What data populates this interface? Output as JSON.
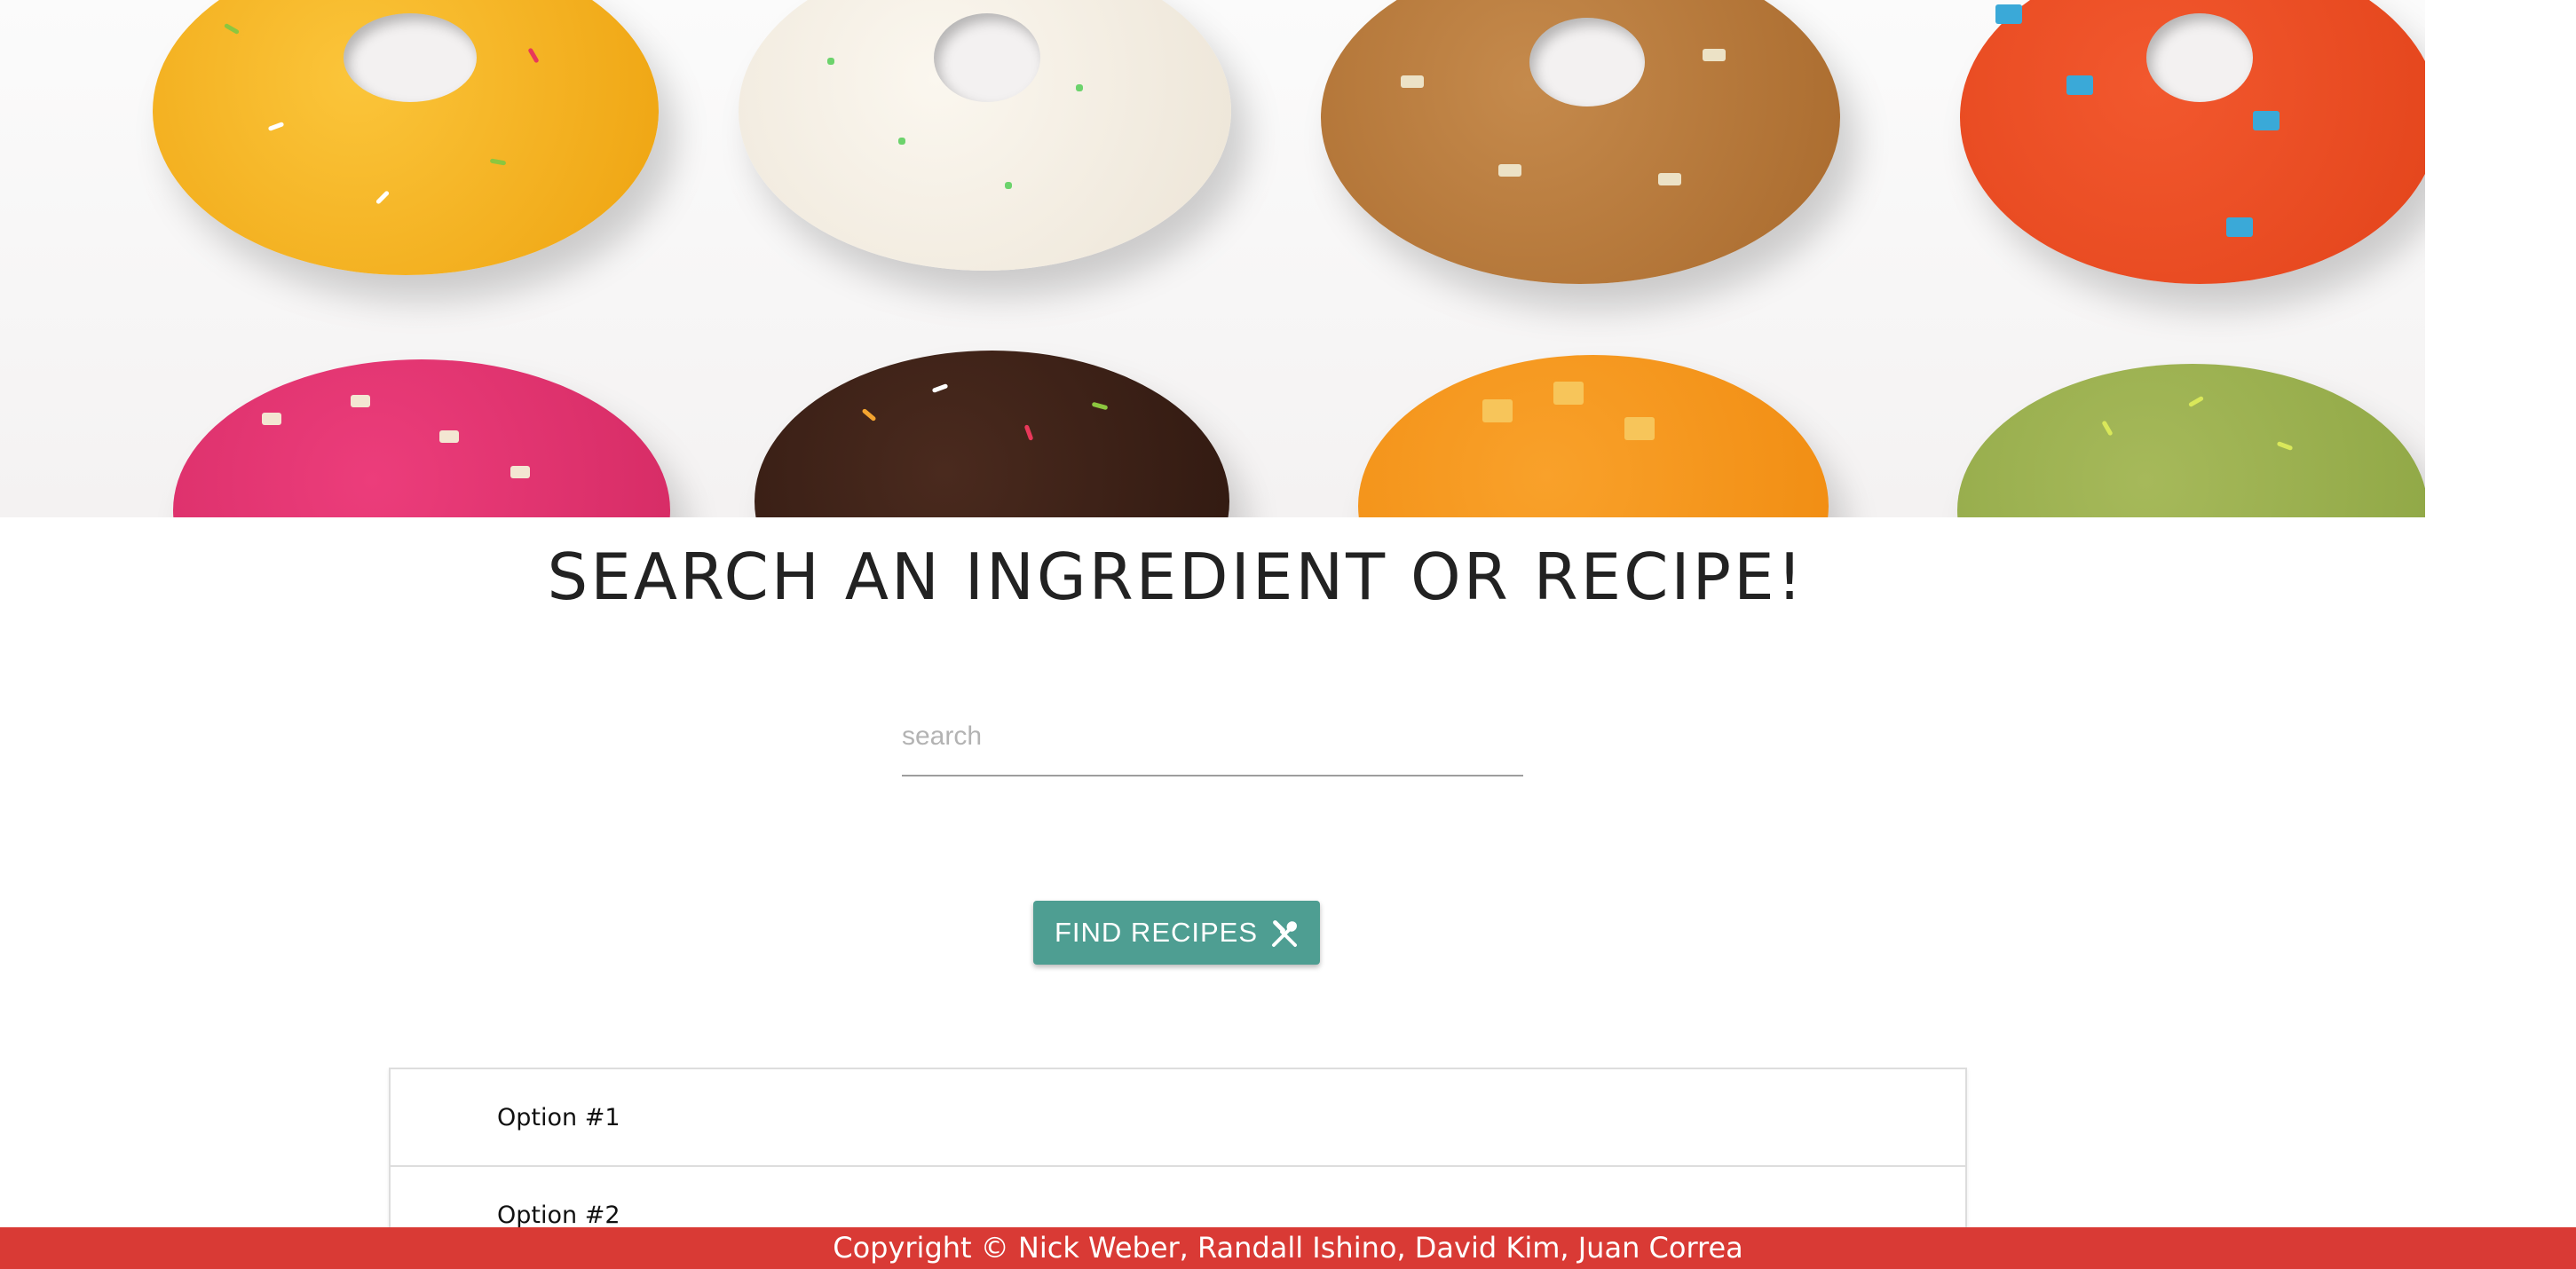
{
  "hero": {
    "image": "donuts-banner"
  },
  "headline": "SEARCH AN INGREDIENT OR RECIPE!",
  "search": {
    "placeholder": "search",
    "value": ""
  },
  "find_button": {
    "label": "FIND RECIPES",
    "icon": "utensils-icon"
  },
  "options": [
    {
      "label": "Option #1"
    },
    {
      "label": "Option #2"
    }
  ],
  "footer": {
    "text": "Copyright © Nick Weber, Randall Ishino, David Kim, Juan Correa"
  },
  "colors": {
    "button": "#4e9e92",
    "footer": "#d93a35",
    "headline": "#222222"
  }
}
